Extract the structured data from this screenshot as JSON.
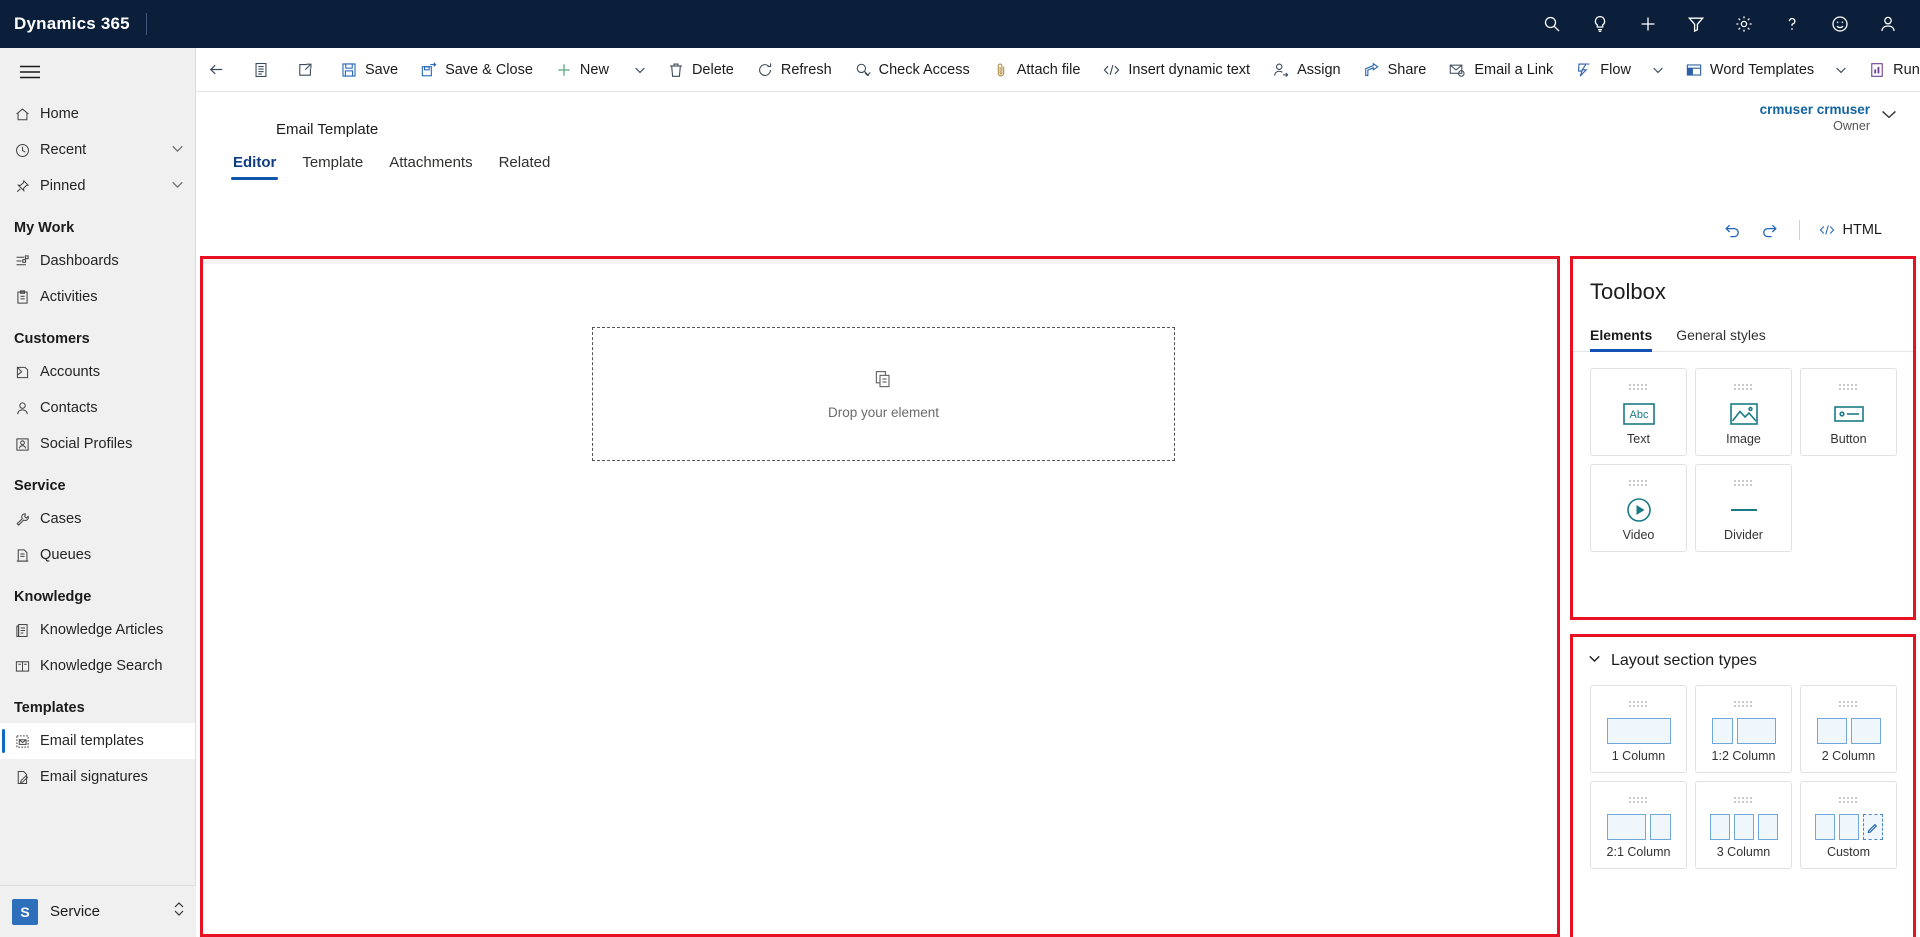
{
  "topnav": {
    "brand": "Dynamics 365",
    "icons": [
      {
        "name": "search-icon",
        "label": "Search"
      },
      {
        "name": "lightbulb-icon",
        "label": "Tips"
      },
      {
        "name": "plus-icon",
        "label": "Quick create"
      },
      {
        "name": "filter-icon",
        "label": "Filter"
      },
      {
        "name": "gear-icon",
        "label": "Settings"
      },
      {
        "name": "question-icon",
        "label": "Help"
      },
      {
        "name": "smiley-icon",
        "label": "Feedback"
      },
      {
        "name": "person-icon",
        "label": "Account manager"
      }
    ]
  },
  "commandbar": {
    "back_label": "Back",
    "form_label": "Show form",
    "popout_label": "Open in new window",
    "items": [
      {
        "label": "Save",
        "icon": "save-icon"
      },
      {
        "label": "Save & Close",
        "icon": "save-close-icon"
      },
      {
        "label": "New",
        "icon": "plus-icon"
      },
      {
        "label": "Delete",
        "icon": "trash-icon"
      },
      {
        "label": "Refresh",
        "icon": "refresh-icon"
      },
      {
        "label": "Check Access",
        "icon": "check-access-icon"
      },
      {
        "label": "Attach file",
        "icon": "paperclip-icon"
      },
      {
        "label": "Insert dynamic text",
        "icon": "code-icon"
      },
      {
        "label": "Assign",
        "icon": "assign-icon"
      },
      {
        "label": "Share",
        "icon": "share-icon"
      },
      {
        "label": "Email a Link",
        "icon": "email-link-icon"
      },
      {
        "label": "Flow",
        "icon": "flow-icon"
      },
      {
        "label": "Word Templates",
        "icon": "word-template-icon"
      },
      {
        "label": "Run Report",
        "icon": "report-icon"
      }
    ]
  },
  "sidebar": {
    "items": [
      {
        "label": "Home",
        "icon": "home-icon",
        "type": "item"
      },
      {
        "label": "Recent",
        "icon": "clock-icon",
        "type": "expander"
      },
      {
        "label": "Pinned",
        "icon": "pin-icon",
        "type": "expander"
      },
      {
        "label": "My Work",
        "type": "group"
      },
      {
        "label": "Dashboards",
        "icon": "dashboard-icon",
        "type": "item"
      },
      {
        "label": "Activities",
        "icon": "activities-icon",
        "type": "item"
      },
      {
        "label": "Customers",
        "type": "group"
      },
      {
        "label": "Accounts",
        "icon": "accounts-icon",
        "type": "item"
      },
      {
        "label": "Contacts",
        "icon": "contact-icon",
        "type": "item"
      },
      {
        "label": "Social Profiles",
        "icon": "social-profile-icon",
        "type": "item"
      },
      {
        "label": "Service",
        "type": "group"
      },
      {
        "label": "Cases",
        "icon": "case-icon",
        "type": "item"
      },
      {
        "label": "Queues",
        "icon": "queue-icon",
        "type": "item"
      },
      {
        "label": "Knowledge",
        "type": "group"
      },
      {
        "label": "Knowledge Articles",
        "icon": "knowledge-article-icon",
        "type": "item"
      },
      {
        "label": "Knowledge Search",
        "icon": "book-icon",
        "type": "item"
      },
      {
        "label": "Templates",
        "type": "group"
      },
      {
        "label": "Email templates",
        "icon": "email-template-icon",
        "type": "item",
        "selected": true
      },
      {
        "label": "Email signatures",
        "icon": "email-signature-icon",
        "type": "item"
      }
    ],
    "area_switcher": {
      "initial": "S",
      "label": "Service"
    }
  },
  "form": {
    "record_title": "Email Template",
    "owner_name": "crmuser crmuser",
    "owner_role": "Owner",
    "tabs": [
      {
        "label": "Editor",
        "active": true
      },
      {
        "label": "Template",
        "active": false
      },
      {
        "label": "Attachments",
        "active": false
      },
      {
        "label": "Related",
        "active": false
      }
    ]
  },
  "editor_toolbar": {
    "undo_label": "Undo",
    "redo_label": "Redo",
    "html_label": "HTML"
  },
  "canvas": {
    "dropzone_label": "Drop your element",
    "dropzone_icon": "drop-element-icon"
  },
  "toolbox": {
    "title": "Toolbox",
    "tabs": [
      {
        "label": "Elements",
        "active": true
      },
      {
        "label": "General styles",
        "active": false
      }
    ],
    "elements": [
      {
        "label": "Text",
        "icon": "text-element-icon"
      },
      {
        "label": "Image",
        "icon": "image-element-icon"
      },
      {
        "label": "Button",
        "icon": "button-element-icon"
      },
      {
        "label": "Video",
        "icon": "video-element-icon"
      },
      {
        "label": "Divider",
        "icon": "divider-element-icon"
      }
    ]
  },
  "layout_sections": {
    "title": "Layout section types",
    "expanded": true,
    "items": [
      {
        "label": "1 Column",
        "cols": [
          1
        ]
      },
      {
        "label": "1:2 Column",
        "cols": [
          1,
          2
        ]
      },
      {
        "label": "2 Column",
        "cols": [
          1,
          1
        ]
      },
      {
        "label": "2:1 Column",
        "cols": [
          2,
          1
        ]
      },
      {
        "label": "3 Column",
        "cols": [
          1,
          1,
          1
        ]
      },
      {
        "label": "Custom",
        "cols": [
          1,
          1
        ],
        "custom": true
      }
    ]
  },
  "colors": {
    "brand_navy": "#0b1f3b",
    "accent_blue": "#0f6cbd",
    "highlight_red": "#e81123",
    "tile_teal": "#1a7b86",
    "layout_blue": "#6ea8dc"
  }
}
